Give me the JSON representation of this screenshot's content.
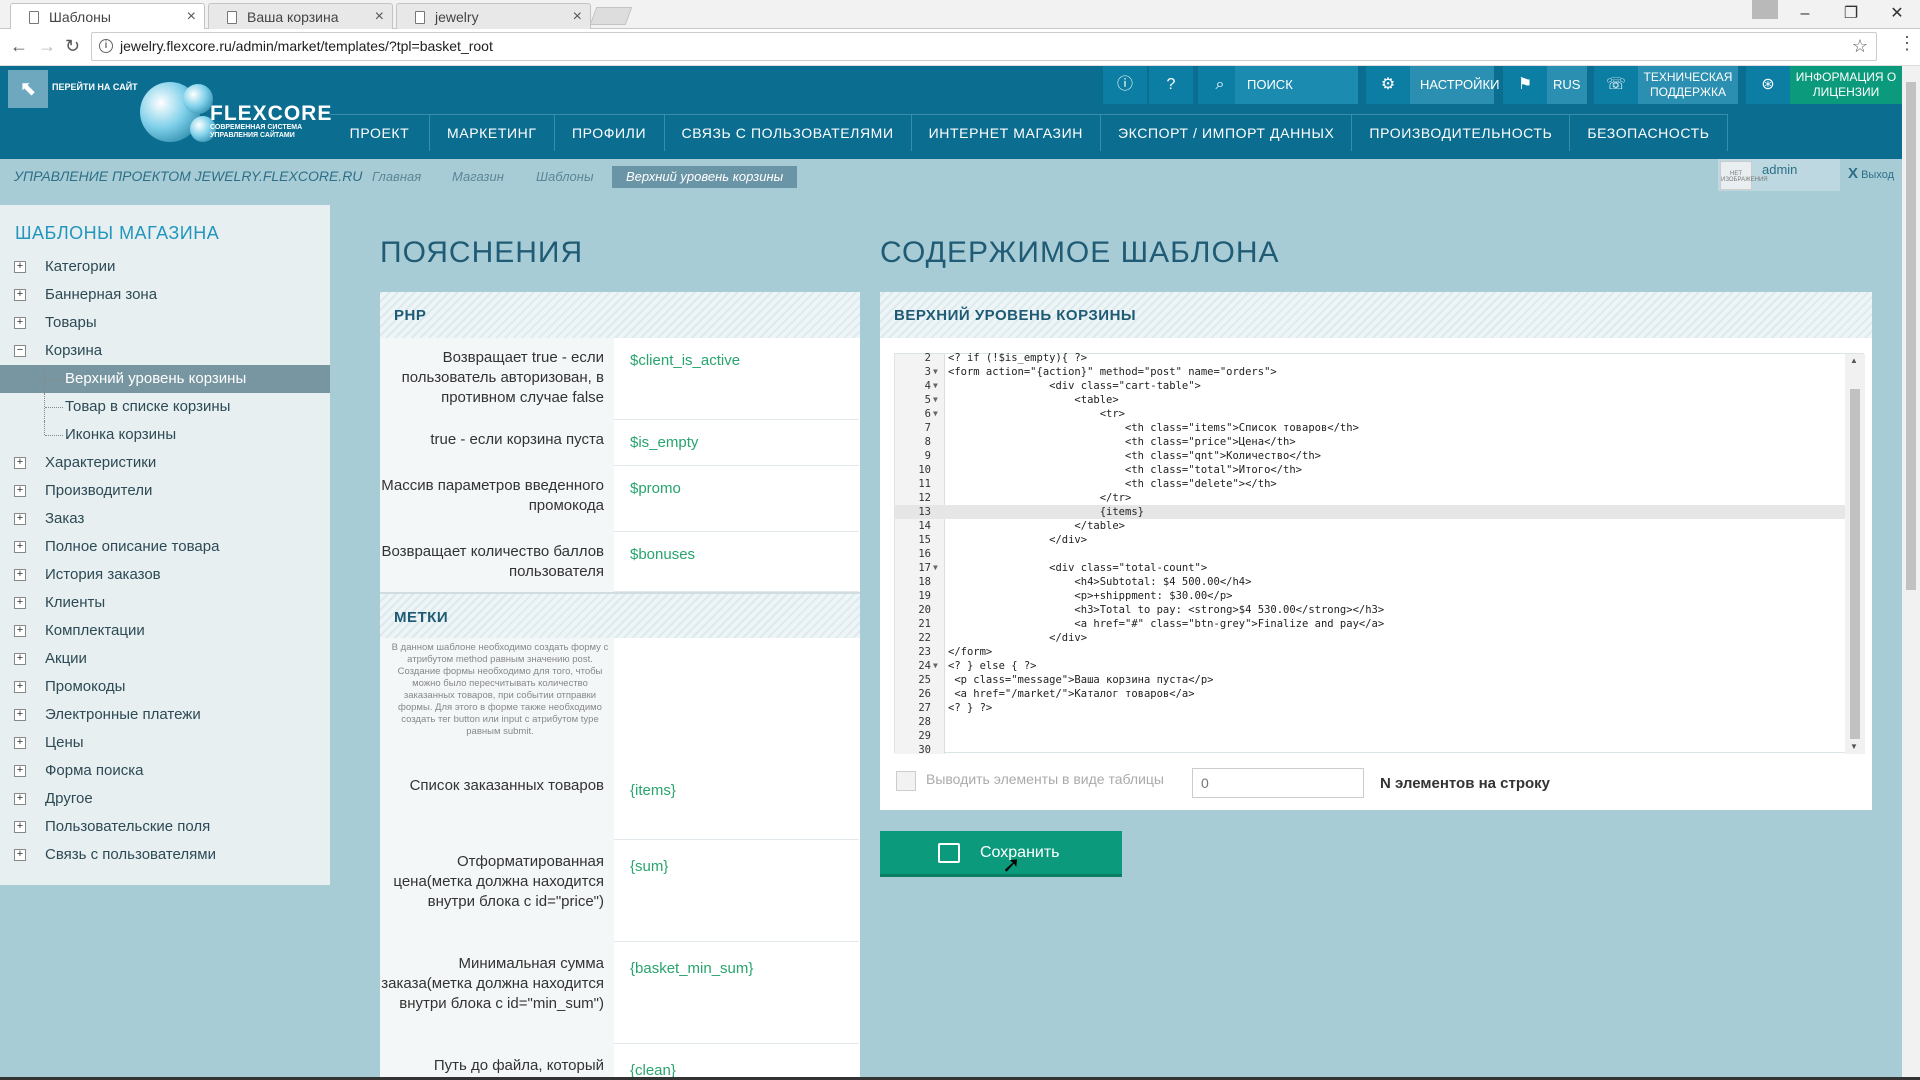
{
  "browser": {
    "tabs": [
      {
        "title": "Шаблоны"
      },
      {
        "title": "Ваша корзина"
      },
      {
        "title": "jewelry"
      }
    ],
    "url": "jewelry.flexcore.ru/admin/market/templates/?tpl=basket_root"
  },
  "header": {
    "goto_site": "ПЕРЕЙТИ НА САЙТ",
    "logo": "FLEXCORE",
    "logo_sub": "СОВРЕМЕННАЯ СИСТЕМА УПРАВЛЕНИЯ САЙТАМИ",
    "search_placeholder": "ПОИСК",
    "settings": "НАСТРОЙКИ",
    "lang": "RUS",
    "support": "ТЕХНИЧЕСКАЯ ПОДДЕРЖКА",
    "license": "ИНФОРМАЦИЯ О ЛИЦЕНЗИИ",
    "menu": [
      "ПРОЕКТ",
      "МАРКЕТИНГ",
      "ПРОФИЛИ",
      "СВЯЗЬ С ПОЛЬЗОВАТЕЛЯМИ",
      "ИНТЕРНЕТ МАГАЗИН",
      "ЭКСПОРТ / ИМПОРТ ДАННЫХ",
      "ПРОИЗВОДИТЕЛЬНОСТЬ",
      "БЕЗОПАСНОСТЬ"
    ]
  },
  "breadcrumb": {
    "project": "УПРАВЛЕНИЕ ПРОЕКТОМ JEWELRY.FLEXCORE.RU",
    "items": [
      "Главная",
      "Магазин",
      "Шаблоны",
      "Верхний уровень корзины"
    ]
  },
  "user": {
    "name": "admin",
    "logout": "Выход",
    "avatar_text": "НЕТ ИЗОБРАЖЕНИЯ"
  },
  "sidebar": {
    "title": "ШАБЛОНЫ МАГАЗИНА",
    "items": [
      {
        "label": "Категории"
      },
      {
        "label": "Баннерная зона"
      },
      {
        "label": "Товары"
      },
      {
        "label": "Корзина"
      },
      {
        "label": "Верхний уровень корзины"
      },
      {
        "label": "Товар в списке корзины"
      },
      {
        "label": "Иконка корзины"
      },
      {
        "label": "Характеристики"
      },
      {
        "label": "Производители"
      },
      {
        "label": "Заказ"
      },
      {
        "label": "Полное описание товара"
      },
      {
        "label": "История заказов"
      },
      {
        "label": "Клиенты"
      },
      {
        "label": "Комплектации"
      },
      {
        "label": "Акции"
      },
      {
        "label": "Промокоды"
      },
      {
        "label": "Электронные платежи"
      },
      {
        "label": "Цены"
      },
      {
        "label": "Форма поиска"
      },
      {
        "label": "Другое"
      },
      {
        "label": "Пользовательские поля"
      },
      {
        "label": "Связь с пользователями"
      }
    ]
  },
  "explanations": {
    "title": "ПОЯСНЕНИЯ",
    "php_header": "PHP",
    "php_rows": [
      {
        "desc": "Возвращает true - если пользователь авторизован, в противном случае false",
        "var": "$client_is_active"
      },
      {
        "desc": "true - если корзина пуста",
        "var": "$is_empty"
      },
      {
        "desc": "Массив параметров введенного промокода",
        "var": "$promo"
      },
      {
        "desc": "Возвращает количество баллов пользователя",
        "var": "$bonuses"
      }
    ],
    "tags_header": "МЕТКИ",
    "note": "В данном шаблоне необходимо создать форму с атрибутом method равным значению post. Создание формы необходимо для того, чтобы можно было пересчитывать количество заказанных товаров, при событии отправки формы. Для этого в форме также необходимо создать тег button или input с атрибутом type равным submit.",
    "tag_rows": [
      {
        "desc": "Список заказанных товаров",
        "var": "{items}"
      },
      {
        "desc": "Отформатированная цена(метка должна находится внутри блока с id=\"price\")",
        "var": "{sum}"
      },
      {
        "desc": "Минимальная сумма заказа(метка должна находится внутри блока с id=\"min_sum\")",
        "var": "{basket_min_sum}"
      },
      {
        "desc": "Путь до файла, который",
        "var": "{clean}"
      }
    ]
  },
  "content": {
    "title": "СОДЕРЖИМОЕ ШАБЛОНА",
    "panel_header": "ВЕРХНИЙ УРОВЕНЬ КОРЗИНЫ",
    "code": [
      {
        "n": "2",
        "t": "<? if (!$is_empty){ ?>"
      },
      {
        "n": "3",
        "t": "<form action=\"{action}\" method=\"post\" name=\"orders\">",
        "fold": true
      },
      {
        "n": "4",
        "t": "                <div class=\"cart-table\">",
        "fold": true
      },
      {
        "n": "5",
        "t": "                    <table>",
        "fold": true
      },
      {
        "n": "6",
        "t": "                        <tr>",
        "fold": true
      },
      {
        "n": "7",
        "t": "                            <th class=\"items\">Список товаров</th>"
      },
      {
        "n": "8",
        "t": "                            <th class=\"price\">Цена</th>"
      },
      {
        "n": "9",
        "t": "                            <th class=\"qnt\">Количество</th>"
      },
      {
        "n": "10",
        "t": "                            <th class=\"total\">Итого</th>"
      },
      {
        "n": "11",
        "t": "                            <th class=\"delete\"></th>"
      },
      {
        "n": "12",
        "t": "                        </tr>"
      },
      {
        "n": "13",
        "t": "                        {items}",
        "hl": true
      },
      {
        "n": "14",
        "t": "                    </table>"
      },
      {
        "n": "15",
        "t": "                </div>"
      },
      {
        "n": "16",
        "t": ""
      },
      {
        "n": "17",
        "t": "                <div class=\"total-count\">",
        "fold": true
      },
      {
        "n": "18",
        "t": "                    <h4>Subtotal: $4 500.00</h4>"
      },
      {
        "n": "19",
        "t": "                    <p>+shippment: $30.00</p>"
      },
      {
        "n": "20",
        "t": "                    <h3>Total to pay: <strong>$4 530.00</strong></h3>"
      },
      {
        "n": "21",
        "t": "                    <a href=\"#\" class=\"btn-grey\">Finalize and pay</a>"
      },
      {
        "n": "22",
        "t": "                </div>"
      },
      {
        "n": "23",
        "t": "</form>"
      },
      {
        "n": "24",
        "t": "<? } else { ?>",
        "fold": true
      },
      {
        "n": "25",
        "t": " <p class=\"message\">Ваша корзина пуста</p>"
      },
      {
        "n": "26",
        "t": " <a href=\"/market/\">Каталог товаров</a>"
      },
      {
        "n": "27",
        "t": "<? } ?>"
      },
      {
        "n": "28",
        "t": ""
      },
      {
        "n": "29",
        "t": ""
      },
      {
        "n": "30",
        "t": ""
      }
    ],
    "table_checkbox_label": "Выводить элементы в виде таблицы",
    "n_value": "0",
    "n_label": "N элементов на строку",
    "save_label": "Сохранить"
  }
}
